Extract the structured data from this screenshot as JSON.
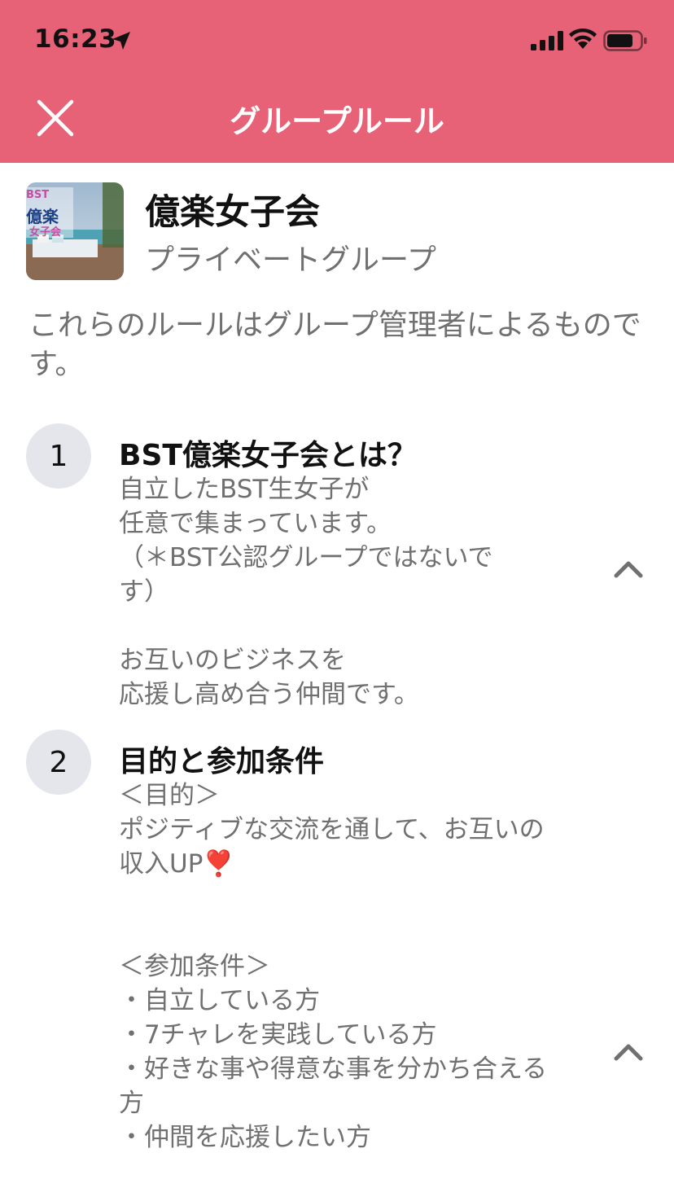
{
  "status_bar": {
    "time": "16:23"
  },
  "header": {
    "title": "グループルール"
  },
  "group": {
    "thumbnail_text_top": "BST",
    "thumbnail_text_mid": "億楽",
    "thumbnail_text_bottom": "女子会",
    "name": "億楽女子会",
    "type": "プライベートグループ"
  },
  "intro": "これらのルールはグループ管理者によるものです。",
  "rules": [
    {
      "number": "1",
      "title": "BST億楽女子会とは？",
      "lines": [
        "自立したBST生女子が",
        "任意で集まっています。",
        "（＊BST公認グループではないで",
        "す）",
        "",
        "お互いのビジネスを",
        "応援し高め合う仲間です。"
      ]
    },
    {
      "number": "2",
      "title": "目的と参加条件",
      "lines": [
        "＜目的＞",
        "ポジティブな交流を通して、お互いの",
        "収入UP❣️",
        "",
        "",
        "＜参加条件＞",
        "・自立している方",
        "・7チャレを実践している方",
        "・好きな事や得意な事を分かち合える",
        "方",
        "・仲間を応援したい方"
      ]
    }
  ],
  "colors": {
    "accent": "#e86277",
    "muted_text": "#707070",
    "chip_bg": "#e5e6eb"
  }
}
